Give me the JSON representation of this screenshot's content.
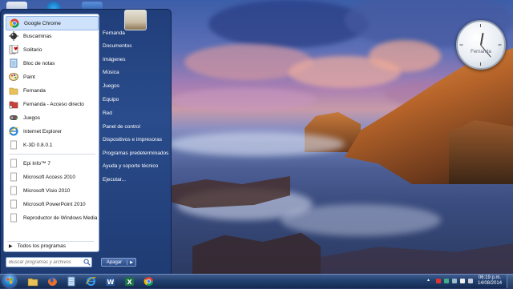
{
  "start_menu": {
    "pinned_apps": [
      {
        "label": "Google Chrome",
        "icon": "chrome-icon"
      },
      {
        "label": "Buscaminas",
        "icon": "minesweeper-icon"
      },
      {
        "label": "Solitario",
        "icon": "solitaire-icon"
      },
      {
        "label": "Bloc de notas",
        "icon": "notepad-icon"
      },
      {
        "label": "Paint",
        "icon": "paint-icon"
      },
      {
        "label": "Fernanda",
        "icon": "folder-icon"
      },
      {
        "label": "Fernanda - Acceso directo",
        "icon": "folder-shortcut-icon"
      },
      {
        "label": "Juegos",
        "icon": "games-icon"
      },
      {
        "label": "Internet Explorer",
        "icon": "ie-icon"
      },
      {
        "label": "K-3D 0.8.0.1",
        "icon": "document-icon"
      },
      {
        "label": "Epi Info™ 7",
        "icon": "document-icon"
      },
      {
        "label": "Microsoft Access 2010",
        "icon": "document-icon"
      },
      {
        "label": "Microsoft Visio 2010",
        "icon": "document-icon"
      },
      {
        "label": "Microsoft PowerPoint 2010",
        "icon": "document-icon"
      },
      {
        "label": "Reproductor de Windows Media",
        "icon": "document-icon"
      }
    ],
    "all_programs": "Todos los programas",
    "search_placeholder": "Buscar programas y archivos",
    "right_links": [
      "Fernanda",
      "Documentos",
      "Imágenes",
      "Música",
      "Juegos",
      "Equipo",
      "Red",
      "Panel de control",
      "Dispositivos e impresoras",
      "Programas predeterminados",
      "Ayuda y soporte técnico",
      "Ejecutar..."
    ],
    "shutdown_label": "Apagar"
  },
  "clock_gadget": {
    "label": "Fernanda"
  },
  "taskbar": {
    "apps": [
      "explorer-icon",
      "firefox-icon",
      "notepad-icon",
      "ie-icon",
      "word-icon",
      "excel-icon",
      "chrome-icon"
    ],
    "time": "06:19 p.m.",
    "date": "14/08/2014"
  },
  "colors": {
    "accent": "#2a4c8c",
    "taskbar": "#22406f",
    "highlight": "#cfe2fb"
  }
}
